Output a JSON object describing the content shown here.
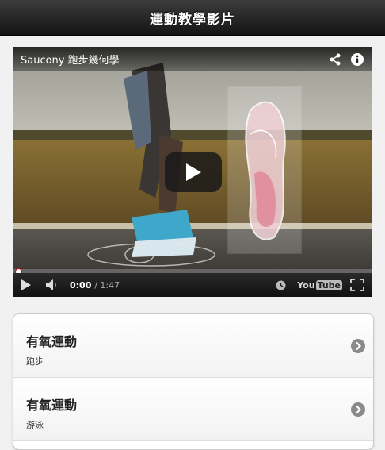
{
  "header": {
    "title": "運動教學影片"
  },
  "video": {
    "title": "Saucony 跑步幾何學",
    "current_time": "0:00",
    "duration": "1:47",
    "progress_fraction": 0.0,
    "logo_you": "You",
    "logo_tube": "Tube"
  },
  "list": {
    "items": [
      {
        "title": "有氧運動",
        "subtitle": "跑步"
      },
      {
        "title": "有氧運動",
        "subtitle": "游泳"
      }
    ]
  },
  "colors": {
    "header_bg": "#1e1e1e",
    "page_bg": "#f1f1f1",
    "progress_accent": "#cc0000"
  }
}
